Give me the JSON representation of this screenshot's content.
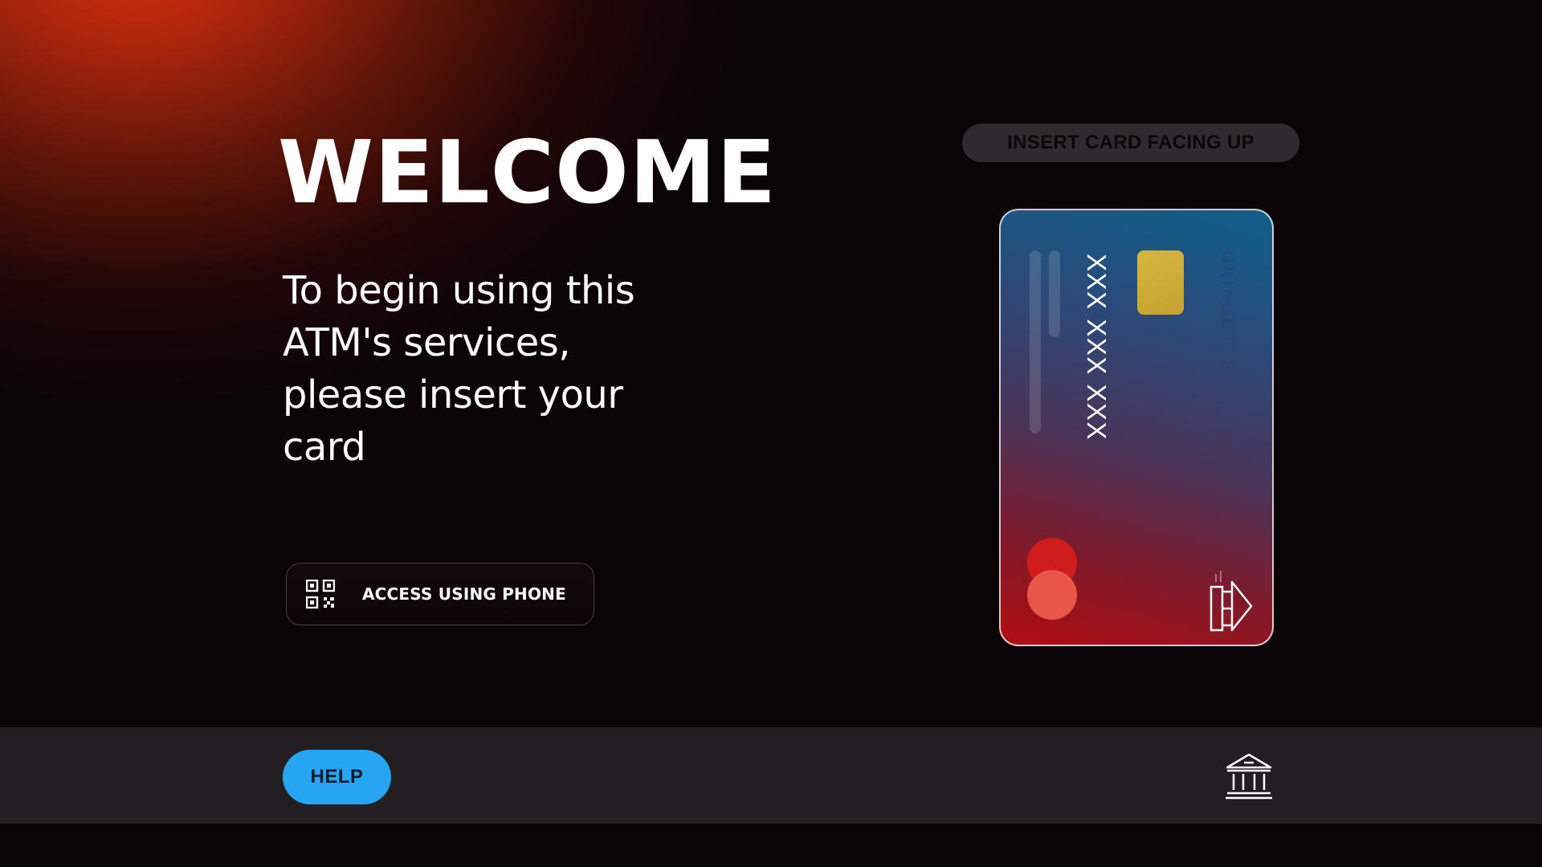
{
  "main": {
    "welcome_title": "WELCOME",
    "instructions": "To begin using this ATM's services, please insert your card",
    "phone_button_label": "ACCESS USING PHONE"
  },
  "card_panel": {
    "insert_hint": "INSERT CARD FACING UP",
    "card_number_masked": "XXX XXX XXX",
    "bank_name": "GRINGOTTS"
  },
  "footer": {
    "help_label": "HELP"
  },
  "icons": {
    "phone_button_icon": "qr-code-icon",
    "footer_icon": "bank-icon",
    "card_contactless": "contactless-icon"
  },
  "colors": {
    "accent_red": "#d8300c",
    "help_button": "#26a6f2",
    "background": "#0b0406",
    "bottom_bar": "#231e21",
    "chip": "#c7a22e"
  }
}
